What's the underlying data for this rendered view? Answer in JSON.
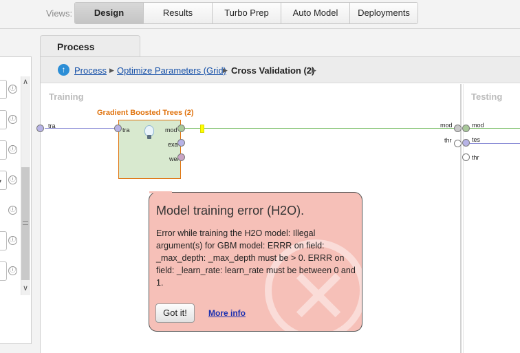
{
  "views": {
    "label": "Views:",
    "items": [
      {
        "label": "Design",
        "active": true
      },
      {
        "label": "Results",
        "active": false
      },
      {
        "label": "Turbo Prep",
        "active": false
      },
      {
        "label": "Auto Model",
        "active": false
      },
      {
        "label": "Deployments",
        "active": false
      }
    ]
  },
  "left_panel": {
    "info_glyph": "ⓘ",
    "dropdown_glyph": "▾",
    "scroll_up": "∧",
    "scroll_down": "∨"
  },
  "process_tab": {
    "label": "Process"
  },
  "breadcrumb": {
    "up_icon": "↑",
    "items": [
      {
        "label": "Process",
        "link": true
      },
      {
        "label": "Optimize Parameters (Grid)",
        "link": true
      },
      {
        "label": "Cross Validation (2)",
        "link": false
      }
    ],
    "separator": "▶"
  },
  "canvas": {
    "training_label": "Training",
    "testing_label": "Testing",
    "operator": {
      "title": "Gradient Boosted Trees (2)",
      "input_port": "tra",
      "output_ports": [
        "mod",
        "exa",
        "wei"
      ]
    },
    "left_input_port": "tra",
    "testing_inputs": [
      {
        "left": "mod",
        "right": "mod"
      },
      {
        "left": "thr",
        "right": "tes"
      },
      {
        "right": "thr"
      }
    ]
  },
  "error_popup": {
    "title": "Model training error (H2O).",
    "message": "Error while training the H2O model: Illegal argument(s) for GBM model: ERRR on field: _max_depth: _max_depth must be > 0. ERRR on field: _learn_rate: learn_rate must be between 0 and 1.",
    "got_it": "Got it!",
    "more_info": "More info"
  },
  "colors": {
    "operator_fill": "#d8e9cf",
    "operator_border": "#e0730e",
    "popup_fill": "#f6c0b8",
    "link": "#1550a8",
    "model_connection": "#7cc06a",
    "data_connection": "#8a8cd6"
  }
}
